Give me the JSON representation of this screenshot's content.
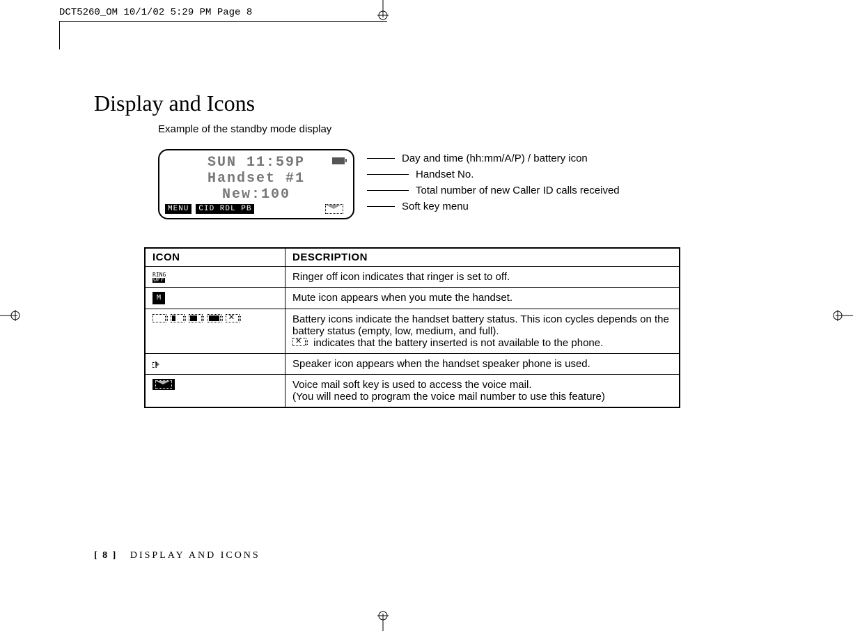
{
  "header": "DCT5260_OM  10/1/02  5:29 PM  Page 8",
  "title": "Display and Icons",
  "subtitle": "Example of the standby mode display",
  "lcd": {
    "line1": "SUN 11:59P",
    "line2": "Handset #1",
    "line3": "New:100",
    "soft1": "MENU",
    "soft2": "CID RDL PB"
  },
  "callouts": {
    "c1": "Day and time (hh:mm/A/P) / battery icon",
    "c2": "Handset No.",
    "c3": "Total number of new Caller ID calls received",
    "c4": "Soft key menu"
  },
  "table": {
    "head_icon": "ICON",
    "head_desc": "DESCRIPTION",
    "rows": [
      {
        "desc": "Ringer off icon indicates that ringer is set to off."
      },
      {
        "desc": "Mute icon appears when you mute the handset."
      },
      {
        "desc_a": "Battery icons indicate the handset battery status. This icon cycles depends on the battery status (empty, low, medium, and full).",
        "desc_b": "indicates that the battery inserted is not available to the phone."
      },
      {
        "desc": "Speaker icon appears when the handset speaker phone is used."
      },
      {
        "desc_a": "Voice mail soft key is used to access the voice mail.",
        "desc_b": "(You will need to program the voice mail number to use this feature)"
      }
    ]
  },
  "footer": {
    "page": "[ 8 ]",
    "section": "DISPLAY AND ICONS"
  }
}
